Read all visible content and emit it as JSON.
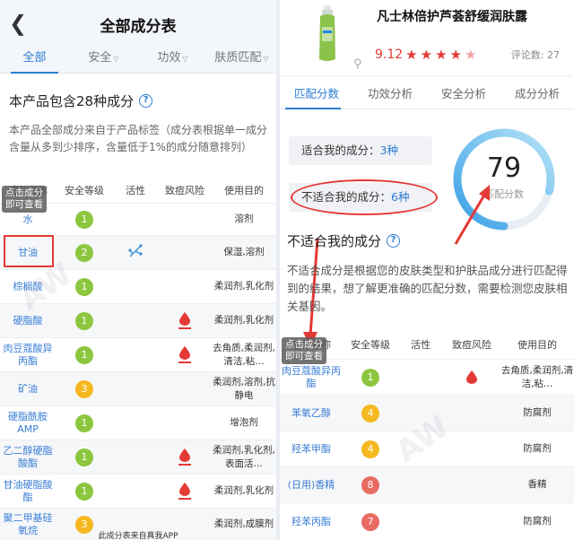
{
  "left": {
    "title": "全部成分表",
    "tabs": [
      {
        "label": "全部",
        "active": true,
        "chevron": false
      },
      {
        "label": "安全",
        "active": false,
        "chevron": true
      },
      {
        "label": "功效",
        "active": false,
        "chevron": true
      },
      {
        "label": "肤质匹配",
        "active": false,
        "chevron": true
      }
    ],
    "summary": "本产品包含28种成分",
    "description": "本产品全部成分来自于产品标签（成分表根据单一成分含量从多到少排序，含量低于1%的成分随意排列）",
    "columns": [
      "成分名称",
      "安全等级",
      "活性",
      "致痘风险",
      "使用目的"
    ],
    "tooltip_line1": "点击成分",
    "tooltip_line2": "即可查看",
    "rows": [
      {
        "name": "水",
        "level": "1",
        "color": "green",
        "active": false,
        "acne": false,
        "purpose": "溶剂"
      },
      {
        "name": "甘油",
        "level": "2",
        "color": "green",
        "active": true,
        "acne": false,
        "purpose": "保湿,溶剂"
      },
      {
        "name": "棕榈酸",
        "level": "1",
        "color": "green",
        "active": false,
        "acne": false,
        "purpose": "柔润剂,乳化剂"
      },
      {
        "name": "硬脂酸",
        "level": "1",
        "color": "green",
        "active": false,
        "acne": true,
        "purpose": "柔润剂,乳化剂"
      },
      {
        "name": "肉豆蔻酸异丙酯",
        "level": "1",
        "color": "green",
        "active": false,
        "acne": true,
        "purpose": "去角质,柔润剂,清洁,粘…"
      },
      {
        "name": "矿油",
        "level": "3",
        "color": "yellow",
        "active": false,
        "acne": false,
        "purpose": "柔润剂,溶剂,抗静电"
      },
      {
        "name": "硬脂酰胺AMP",
        "level": "1",
        "color": "green",
        "active": false,
        "acne": false,
        "purpose": "增泡剂"
      },
      {
        "name": "乙二醇硬脂酸酯",
        "level": "1",
        "color": "green",
        "active": false,
        "acne": true,
        "purpose": "柔润剂,乳化剂,表面活…"
      },
      {
        "name": "甘油硬脂酸酯",
        "level": "1",
        "color": "green",
        "active": false,
        "acne": true,
        "purpose": "柔润剂,乳化剂"
      },
      {
        "name": "聚二甲基硅氧烷",
        "level": "3",
        "color": "yellow",
        "active": false,
        "acne": false,
        "purpose": "柔润剂,成膜剂"
      }
    ],
    "footer": "此成分表来自真我APP"
  },
  "right": {
    "product_name": "凡士林倍护芦荟舒缓润肤露",
    "score": "9.12",
    "stars": 4.5,
    "review_count": "评论数: 27",
    "tabs": [
      {
        "label": "匹配分数",
        "active": true
      },
      {
        "label": "功效分析",
        "active": false
      },
      {
        "label": "安全分析",
        "active": false
      },
      {
        "label": "成分分析",
        "active": false
      }
    ],
    "suitable_label": "适合我的成分：",
    "suitable_count": "3种",
    "unsuitable_label": "不适合我的成分：",
    "unsuitable_count": "6种",
    "match_score": "79",
    "match_fraction": 0.79,
    "match_label": "匹配分数",
    "section_title": "不适合我的成分",
    "section_desc": "不适合成分是根据您的皮肤类型和护肤品成分进行匹配得到的结果，想了解更准确的匹配分数，需要检测您皮肤相关基因。",
    "columns": [
      "成分名称",
      "安全等级",
      "活性",
      "致痘风险",
      "使用目的"
    ],
    "tooltip_line1": "点击成分",
    "tooltip_line2": "即可查看",
    "rows": [
      {
        "name": "肉豆蔻酸异丙酯",
        "level": "1",
        "color": "green",
        "acne": true,
        "purpose": "去角质,柔润剂,清洁,粘…"
      },
      {
        "name": "苯氧乙醇",
        "level": "4",
        "color": "yellow",
        "acne": false,
        "purpose": "防腐剂"
      },
      {
        "name": "羟苯甲酯",
        "level": "4",
        "color": "yellow",
        "acne": false,
        "purpose": "防腐剂"
      },
      {
        "name": "(日用)香精",
        "level": "8",
        "color": "red",
        "acne": false,
        "purpose": "香精"
      },
      {
        "name": "羟苯丙酯",
        "level": "7",
        "color": "red",
        "acne": false,
        "purpose": "防腐剂"
      }
    ]
  }
}
